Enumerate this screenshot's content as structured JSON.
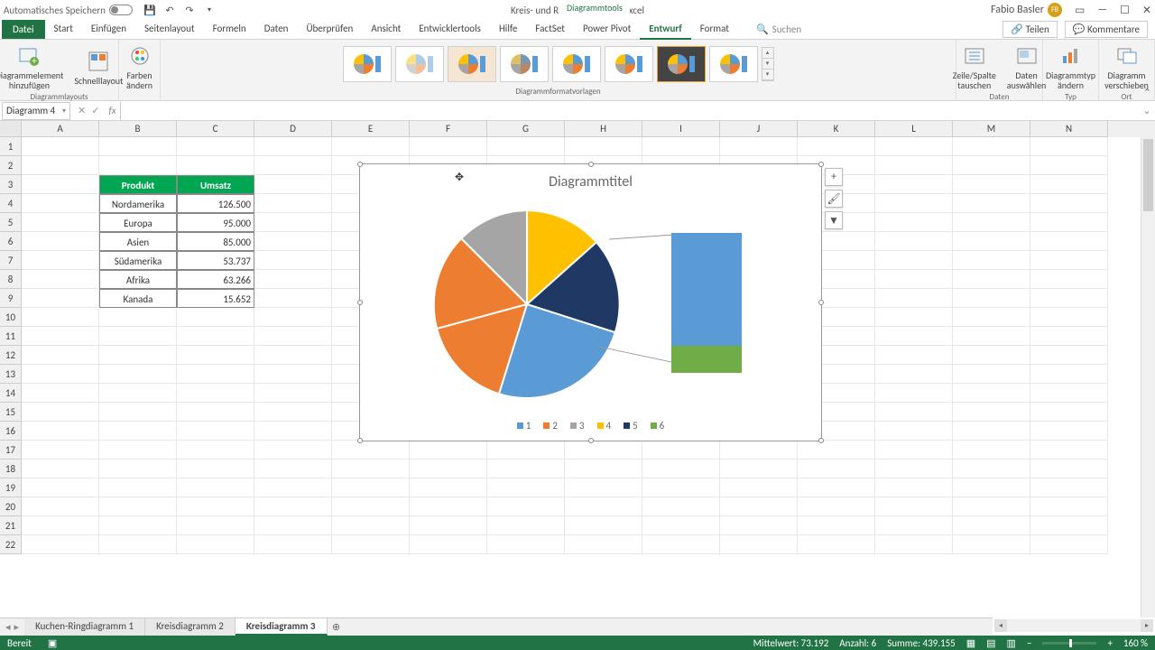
{
  "titlebar": {
    "autosave": "Automatisches Speichern",
    "doc_title": "Kreis- und Ringdiagramme - Excel",
    "tool_tab": "Diagrammtools",
    "user": "Fabio Basler",
    "user_initials": "FB"
  },
  "tabs": {
    "file": "Datei",
    "items": [
      "Start",
      "Einfügen",
      "Seitenlayout",
      "Formeln",
      "Daten",
      "Überprüfen",
      "Ansicht",
      "Entwicklertools",
      "Hilfe",
      "FactSet",
      "Power Pivot",
      "Entwurf",
      "Format"
    ],
    "active": "Entwurf",
    "search": "Suchen",
    "share": "Teilen",
    "comments": "Kommentare"
  },
  "ribbon": {
    "layouts": {
      "elem": "Diagrammelement\nhinzufügen",
      "quick": "Schnelllayout",
      "colors": "Farben\nändern",
      "group": "Diagrammlayouts"
    },
    "styles_group": "Diagrammformatvorlagen",
    "data": {
      "switch": "Zeile/Spalte\ntauschen",
      "select": "Daten\nauswählen",
      "group": "Daten"
    },
    "type": {
      "change": "Diagrammtyp\nändern",
      "group": "Typ"
    },
    "loc": {
      "move": "Diagramm\nverschieben",
      "group": "Ort"
    }
  },
  "namebox": "Diagramm 4",
  "columns": [
    "A",
    "B",
    "C",
    "D",
    "E",
    "F",
    "G",
    "H",
    "I",
    "J",
    "K",
    "L",
    "M",
    "N"
  ],
  "row_count": 22,
  "table": {
    "header": {
      "c1": "Produkt",
      "c2": "Umsatz"
    },
    "rows": [
      {
        "p": "Nordamerika",
        "u": "126.500"
      },
      {
        "p": "Europa",
        "u": "95.000"
      },
      {
        "p": "Asien",
        "u": "85.000"
      },
      {
        "p": "Südamerika",
        "u": "53.737"
      },
      {
        "p": "Afrika",
        "u": "63.266"
      },
      {
        "p": "Kanada",
        "u": "15.652"
      }
    ]
  },
  "chart": {
    "title": "Diagrammtitel",
    "legend": [
      "1",
      "2",
      "3",
      "4",
      "5",
      "6"
    ],
    "legend_colors": [
      "#5b9bd5",
      "#ed7d31",
      "#a5a5a5",
      "#ffc000",
      "#1f3864",
      "#70ad47"
    ]
  },
  "chart_data": {
    "type": "pie",
    "title": "Diagrammtitel",
    "categories": [
      "Nordamerika",
      "Europa",
      "Asien",
      "Südamerika",
      "Afrika",
      "Kanada"
    ],
    "values": [
      126500,
      95000,
      85000,
      53737,
      63266,
      15652
    ],
    "series_name": "Umsatz",
    "subtype": "bar_of_pie"
  },
  "sheets": {
    "items": [
      "Kuchen-Ringdiagramm 1",
      "Kreisdiagramm 2",
      "Kreisdiagramm 3"
    ],
    "active": 2
  },
  "status": {
    "ready": "Bereit",
    "avg": "Mittelwert: 73.192",
    "count": "Anzahl: 6",
    "sum": "Summe: 439.155",
    "zoom": "160 %"
  }
}
